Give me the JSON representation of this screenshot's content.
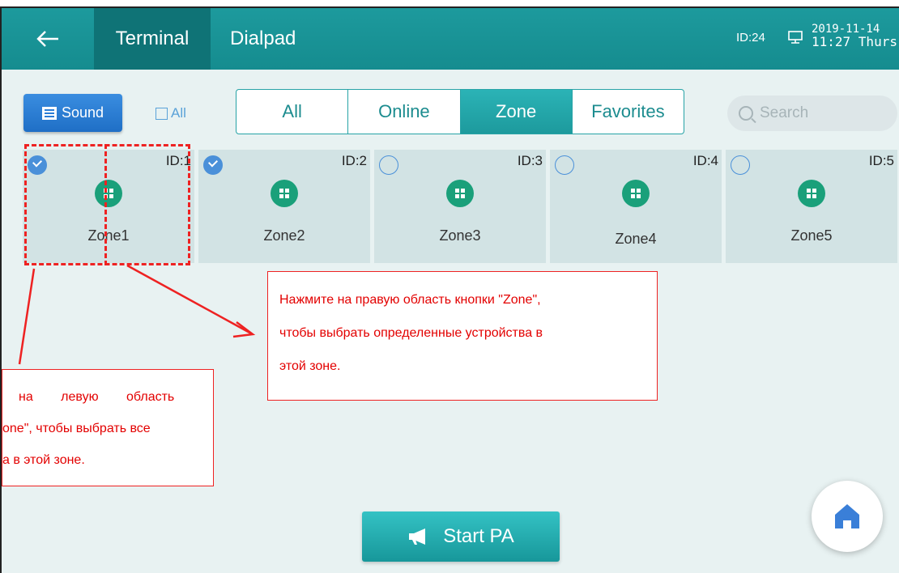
{
  "topbar": {
    "back_icon": "arrow-left-icon",
    "tab_terminal": "Terminal",
    "tab_dialpad": "Dialpad",
    "device_id": "ID:24",
    "monitor_icon": "monitor-icon",
    "date": "2019-11-14",
    "time_day": "11:27 Thurs"
  },
  "toolbar": {
    "sound_label": "Sound",
    "all_label": "All",
    "search_placeholder": "Search"
  },
  "filters": [
    "All",
    "Online",
    "Zone",
    "Favorites"
  ],
  "active_filter": "Zone",
  "zones": [
    {
      "id": "ID:1",
      "name": "Zone1",
      "checked": true
    },
    {
      "id": "ID:2",
      "name": "Zone2",
      "checked": true
    },
    {
      "id": "ID:3",
      "name": "Zone3",
      "checked": false
    },
    {
      "id": "ID:4",
      "name": "Zone4",
      "checked": false
    },
    {
      "id": "ID:5",
      "name": "Zone5",
      "checked": false
    }
  ],
  "callouts": {
    "right": [
      "Нажмите на правую область кнопки \"Zone\",",
      "чтобы выбрать определенные устройства в",
      "этой зоне."
    ],
    "left": [
      "на левую область",
      "one\", чтобы выбрать все",
      "а в этой зоне."
    ]
  },
  "start_pa": "Start PA",
  "colors": {
    "topbar": "#1d9a9d",
    "active_tab": "#0f7376",
    "annotation": "#e22222",
    "zone_icon": "#1aa07a",
    "checkbox": "#4a90d9",
    "home_icon": "#3a7fd8"
  }
}
